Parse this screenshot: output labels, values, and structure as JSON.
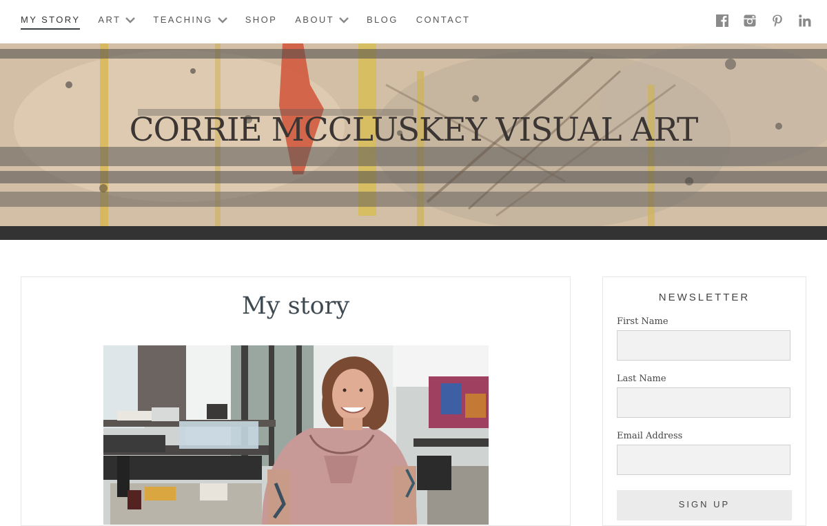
{
  "nav": {
    "items": [
      {
        "label": "MY STORY"
      },
      {
        "label": "ART"
      },
      {
        "label": "TEACHING"
      },
      {
        "label": "SHOP"
      },
      {
        "label": "ABOUT"
      },
      {
        "label": "BLOG"
      },
      {
        "label": "CONTACT"
      }
    ],
    "social": [
      "facebook-icon",
      "instagram-icon",
      "pinterest-icon",
      "linkedin-icon"
    ]
  },
  "banner": {
    "title": "CORRIE MCCLUSKEY VISUAL ART"
  },
  "main": {
    "title": "My story"
  },
  "newsletter": {
    "title": "NEWSLETTER",
    "first_name_label": "First Name",
    "last_name_label": "Last Name",
    "email_label": "Email Address",
    "button_label": "SIGN UP"
  },
  "colors": {
    "nav_text": "#555555",
    "dark_bar": "#333333",
    "title_text": "#3f4a52"
  }
}
